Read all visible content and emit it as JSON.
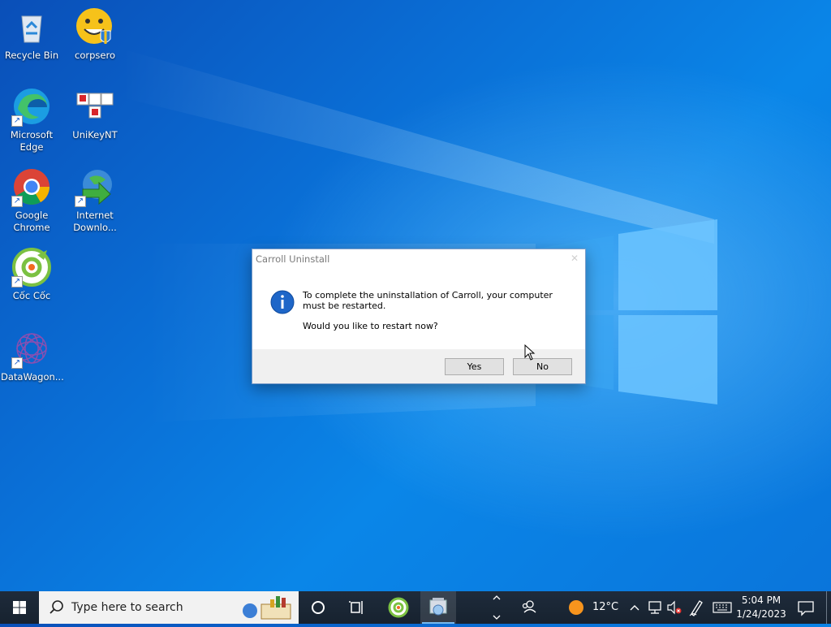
{
  "desktop": {
    "icons": [
      {
        "label": "Recycle Bin",
        "icon": "recycle-bin-icon"
      },
      {
        "label": "corpsero",
        "icon": "smiley-shield-icon"
      },
      {
        "label": "Microsoft Edge",
        "icon": "edge-icon"
      },
      {
        "label": "UniKeyNT",
        "icon": "unikey-icon"
      },
      {
        "label": "Google Chrome",
        "icon": "chrome-icon"
      },
      {
        "label": "Internet Downlo...",
        "icon": "idm-icon"
      },
      {
        "label": "Cốc Cốc",
        "icon": "coccoc-icon"
      },
      {
        "label": "DataWagon...",
        "icon": "datawagon-icon"
      }
    ]
  },
  "dialog": {
    "title": "Carroll Uninstall",
    "close_glyph": "✕",
    "message": "To complete the uninstallation of Carroll, your computer must be restarted.",
    "question": "Would you like to restart now?",
    "yes_label": "Yes",
    "no_label": "No",
    "icon": "info-icon"
  },
  "taskbar": {
    "search_placeholder": "Type here to search",
    "weather_temp": "12°C",
    "time": "5:04 PM",
    "date": "1/24/2023",
    "accent": "#76b9ed"
  },
  "colors": {
    "wallpaper": "#0a74da",
    "taskbar": "#1c2a3a",
    "dialog_footer": "#f0f0f0"
  }
}
